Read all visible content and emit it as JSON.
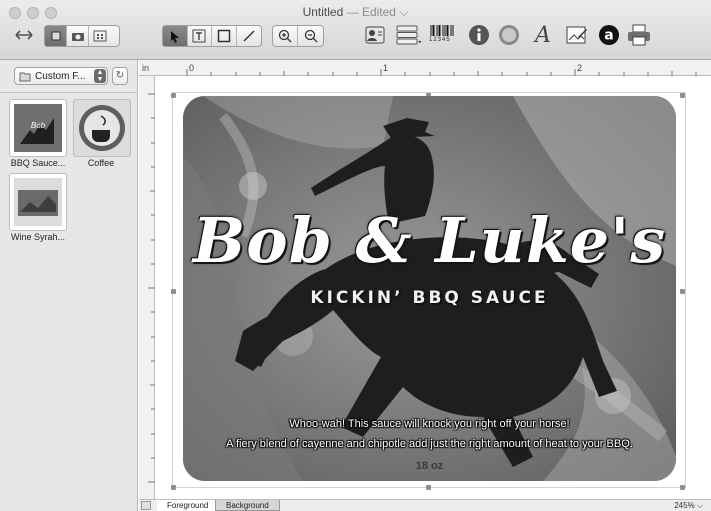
{
  "window": {
    "title": "Untitled",
    "separator": "—",
    "status": "Edited",
    "status_chevron": "⌵"
  },
  "toolbar": {
    "barcode_digits": "12345"
  },
  "sidebar": {
    "select_value": "Custom F...",
    "items": [
      {
        "label": "BBQ Sauce..."
      },
      {
        "label": "Coffee"
      },
      {
        "label": "Wine Syrah..."
      }
    ]
  },
  "ruler": {
    "unit": "in",
    "marks": [
      "0",
      "1",
      "2"
    ]
  },
  "label": {
    "title": "Bob & Luke's",
    "subtitle": "KICKIN’ BBQ SAUCE",
    "line1": "Whoo-wah! This sauce will knock you right off your horse!",
    "line2": "A fiery blend of cayenne and chipotle add just the right amount of heat to your BBQ.",
    "size": "18 oz"
  },
  "bottom": {
    "tabs": [
      "Foreground",
      "Background"
    ],
    "zoom": "245%",
    "zoom_chevron": "⌵"
  }
}
